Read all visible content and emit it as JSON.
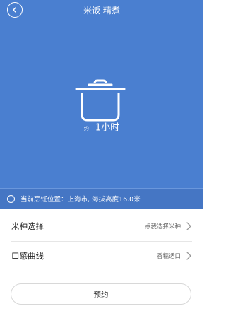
{
  "header": {
    "title": "米饭 精煮",
    "back_icon": "chevron-left-icon"
  },
  "hero": {
    "background_color": "#4a7fd0",
    "icon": "rice-cooker-pot-icon",
    "time_prefix": "约",
    "time_value": "1小时"
  },
  "location": {
    "icon": "info-icon",
    "text": "当前烹饪位置：上海市, 海拔高度16.0米"
  },
  "settings": [
    {
      "label": "米种选择",
      "value": "点我选择米种"
    },
    {
      "label": "口感曲线",
      "value": "香糯适口"
    }
  ],
  "actions": {
    "reserve_label": "预约"
  }
}
